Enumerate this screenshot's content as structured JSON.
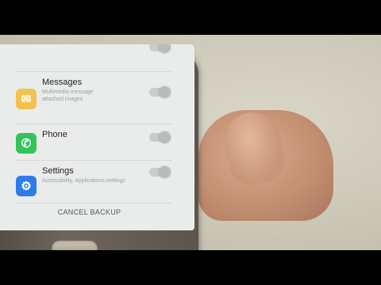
{
  "apps": [
    {
      "name": "Messages",
      "details": [
        "Multimedia message",
        "attached images"
      ],
      "icon": "envelope-icon",
      "color": "#f2c14e"
    },
    {
      "name": "Phone",
      "details": [],
      "icon": "phone-icon",
      "color": "#33c45a"
    },
    {
      "name": "Settings",
      "details": [
        "Accessibility, Applications settings"
      ],
      "icon": "gear-icon",
      "color": "#2f7ce8"
    }
  ],
  "cancel_label": "CANCEL BACKUP",
  "glyphs": {
    "envelope": "✉",
    "phone": "✆",
    "gear": "⚙"
  }
}
